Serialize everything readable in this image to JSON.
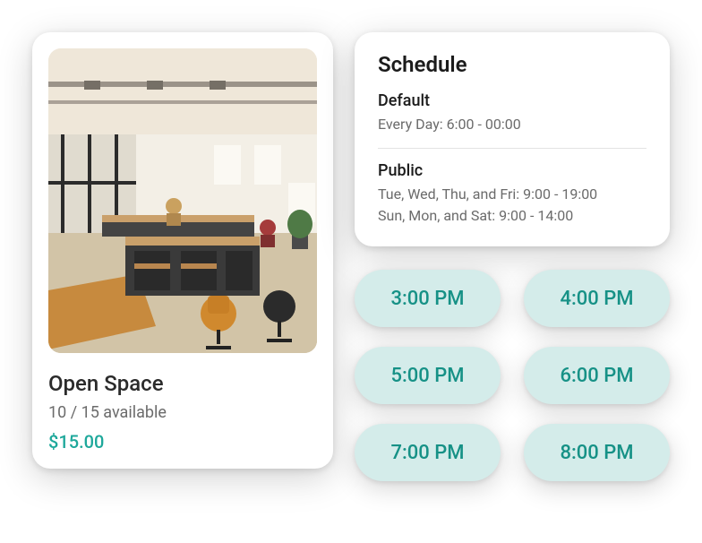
{
  "space": {
    "title": "Open Space",
    "availability": "10 / 15 available",
    "price": "$15.00"
  },
  "schedule": {
    "heading": "Schedule",
    "sections": [
      {
        "label": "Default",
        "lines": [
          "Every Day: 6:00 - 00:00"
        ]
      },
      {
        "label": "Public",
        "lines": [
          "Tue, Wed, Thu, and Fri: 9:00 - 19:00",
          "Sun, Mon, and Sat: 9:00 - 14:00"
        ]
      }
    ]
  },
  "time_slots": [
    "3:00 PM",
    "4:00 PM",
    "5:00 PM",
    "6:00 PM",
    "7:00 PM",
    "8:00 PM"
  ],
  "colors": {
    "accent": "#1ea89b",
    "pill_bg": "#d4ecea",
    "pill_text": "#169186"
  }
}
